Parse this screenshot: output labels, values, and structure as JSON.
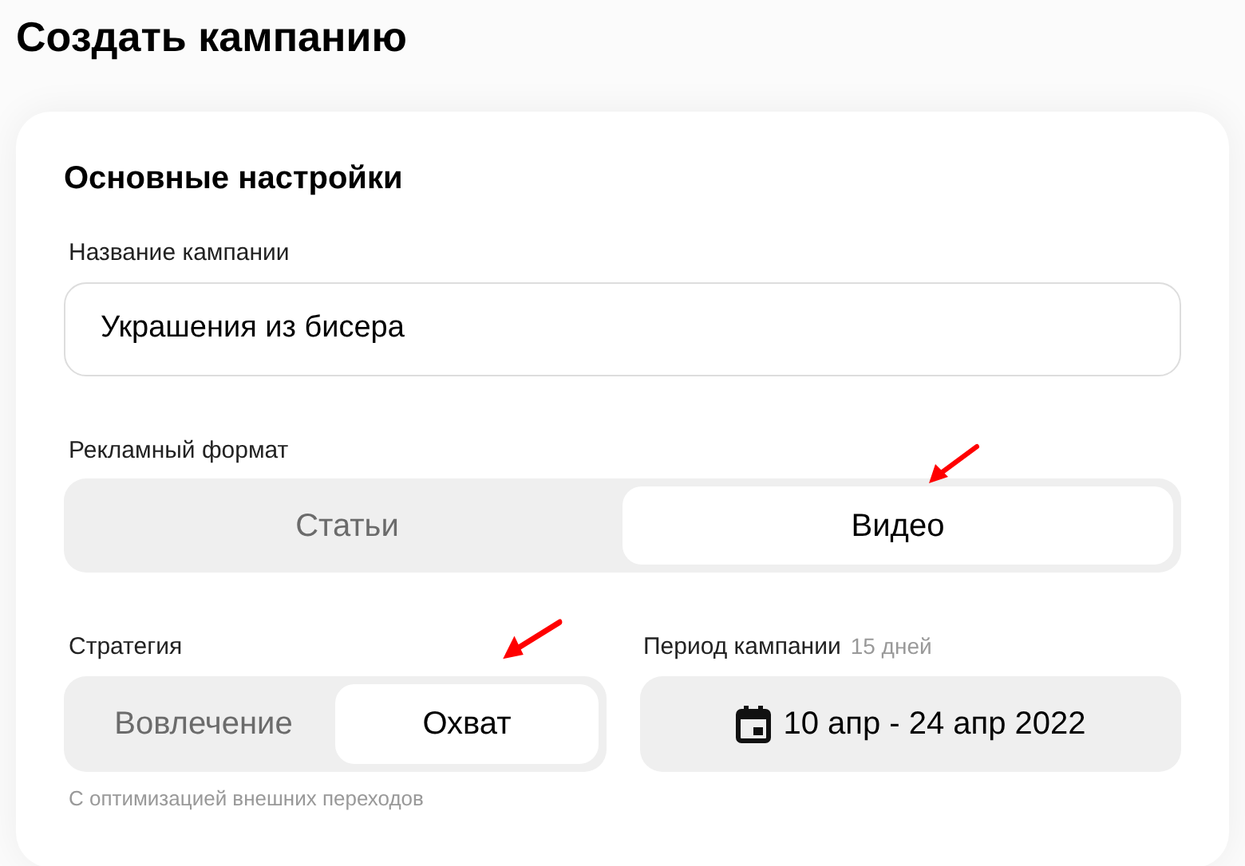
{
  "page_title": "Создать кампанию",
  "section_title": "Основные настройки",
  "campaign_name": {
    "label": "Название кампании",
    "value": "Украшения из бисера"
  },
  "ad_format": {
    "label": "Рекламный формат",
    "options": [
      {
        "label": "Статьи",
        "selected": false
      },
      {
        "label": "Видео",
        "selected": true
      }
    ]
  },
  "strategy": {
    "label": "Стратегия",
    "options": [
      {
        "label": "Вовлечение",
        "selected": false
      },
      {
        "label": "Охват",
        "selected": true
      }
    ],
    "hint": "С оптимизацией внешних переходов"
  },
  "period": {
    "label": "Период кампании",
    "duration": "15 дней",
    "value": "10 апр - 24 апр 2022"
  }
}
